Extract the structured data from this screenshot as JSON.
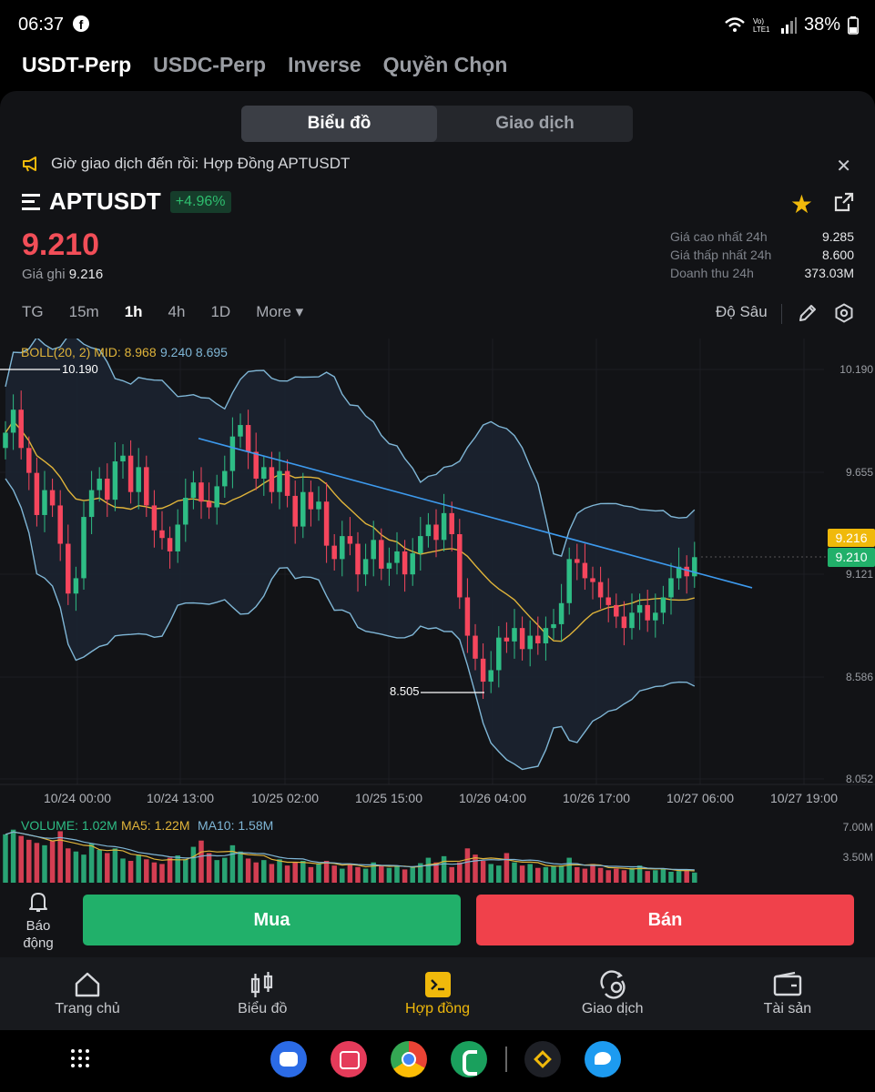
{
  "status": {
    "time": "06:37",
    "battery": "38%",
    "lte": "Vo) LTE1"
  },
  "top_tabs": [
    "USDT-Perp",
    "USDC-Perp",
    "Inverse",
    "Quyền Chọn"
  ],
  "segment": {
    "chart": "Biểu đồ",
    "trade": "Giao dịch"
  },
  "notice": "Giờ giao dịch đến rồi: Hợp Đồng APTUSDT",
  "symbol": {
    "name": "APTUSDT",
    "change": "+4.96%",
    "price": "9.210",
    "mark_label": "Giá ghi",
    "mark_value": "9.216"
  },
  "stats": [
    {
      "k": "Giá cao nhất 24h",
      "v": "9.285"
    },
    {
      "k": "Giá thấp nhất 24h",
      "v": "8.600"
    },
    {
      "k": "Doanh thu 24h",
      "v": "373.03M"
    }
  ],
  "timeframes": {
    "tg": "TG",
    "m15": "15m",
    "h1": "1h",
    "h4": "4h",
    "d1": "1D",
    "more": "More ▾"
  },
  "depth_label": "Độ Sâu",
  "boll": {
    "label": "BOLL(20, 2) MID: 8.968",
    "up_low": "9.240 8.695"
  },
  "volume_legend": {
    "vol": "VOLUME: 1.02M",
    "ma5": "MA5: 1.22M",
    "ma10": "MA10: 1.58M"
  },
  "colors": {
    "up": "#2ebd85",
    "down": "#f6465d",
    "accent": "#f0b90b",
    "boll": "#7fb6d6",
    "mid": "#e0b43a",
    "trend": "#3d9aee"
  },
  "chart_data": {
    "type": "candlestick",
    "y_ticks": [
      "10.190",
      "9.655",
      "9.121",
      "8.586",
      "8.052"
    ],
    "x_ticks": [
      "10/24 00:00",
      "10/24 13:00",
      "10/25 02:00",
      "10/25 15:00",
      "10/26 04:00",
      "10/26 17:00",
      "10/27 06:00",
      "10/27 19:00"
    ],
    "ylim": [
      8.052,
      10.19
    ],
    "high_marker": "10.190",
    "low_marker": "8.505",
    "mark_tag": "9.216",
    "last_tag": "9.210",
    "vol_ticks": [
      "7.00M",
      "3.50M"
    ],
    "trendline": [
      [
        9.83,
        49
      ],
      [
        9.05,
        175
      ]
    ],
    "candles_close": [
      9.86,
      9.98,
      9.78,
      9.65,
      9.43,
      9.56,
      9.48,
      9.28,
      9.02,
      9.1,
      9.42,
      9.56,
      9.62,
      9.51,
      9.71,
      9.74,
      9.55,
      9.68,
      9.48,
      9.35,
      9.31,
      9.24,
      9.38,
      9.52,
      9.6,
      9.5,
      9.47,
      9.58,
      9.66,
      9.84,
      9.9,
      9.76,
      9.62,
      9.68,
      9.55,
      9.66,
      9.53,
      9.37,
      9.55,
      9.46,
      9.5,
      9.27,
      9.2,
      9.32,
      9.28,
      9.12,
      9.2,
      9.3,
      9.15,
      9.18,
      9.24,
      9.12,
      9.23,
      9.32,
      9.38,
      9.3,
      9.44,
      9.33,
      9.0,
      8.8,
      8.68,
      8.56,
      8.62,
      8.79,
      8.77,
      8.84,
      8.73,
      8.8,
      8.76,
      8.84,
      8.86,
      8.97,
      9.2,
      9.18,
      9.1,
      9.08,
      9.0,
      8.96,
      8.9,
      8.84,
      8.92,
      8.96,
      8.88,
      8.92,
      9.0,
      9.1,
      9.16,
      9.11,
      9.21
    ],
    "volumes": [
      6.2,
      6.8,
      6.0,
      5.5,
      5.1,
      4.8,
      5.4,
      6.6,
      4.4,
      4.0,
      3.6,
      5.0,
      4.2,
      3.8,
      4.4,
      3.1,
      2.8,
      3.6,
      3.0,
      2.6,
      2.4,
      3.2,
      3.5,
      3.0,
      4.6,
      5.4,
      3.8,
      2.9,
      3.2,
      4.8,
      4.0,
      3.1,
      2.6,
      2.9,
      2.4,
      3.0,
      2.2,
      2.6,
      2.8,
      2.0,
      2.5,
      2.8,
      2.2,
      1.8,
      2.4,
      2.0,
      1.8,
      2.6,
      2.2,
      1.9,
      2.2,
      1.7,
      2.0,
      2.5,
      3.2,
      2.6,
      3.4,
      2.0,
      2.6,
      4.4,
      3.6,
      2.8,
      2.4,
      2.2,
      3.8,
      2.6,
      2.2,
      2.4,
      1.9,
      2.0,
      2.1,
      2.2,
      3.2,
      2.0,
      1.8,
      2.4,
      1.9,
      1.6,
      1.8,
      1.6,
      1.9,
      2.2,
      1.5,
      1.6,
      1.8,
      1.4,
      1.5,
      1.6,
      1.3
    ]
  },
  "buy": "Mua",
  "sell": "Bán",
  "alarm": "Báo động",
  "nav": [
    "Trang chủ",
    "Biểu đồ",
    "Hợp đồng",
    "Giao dịch",
    "Tài sản"
  ]
}
